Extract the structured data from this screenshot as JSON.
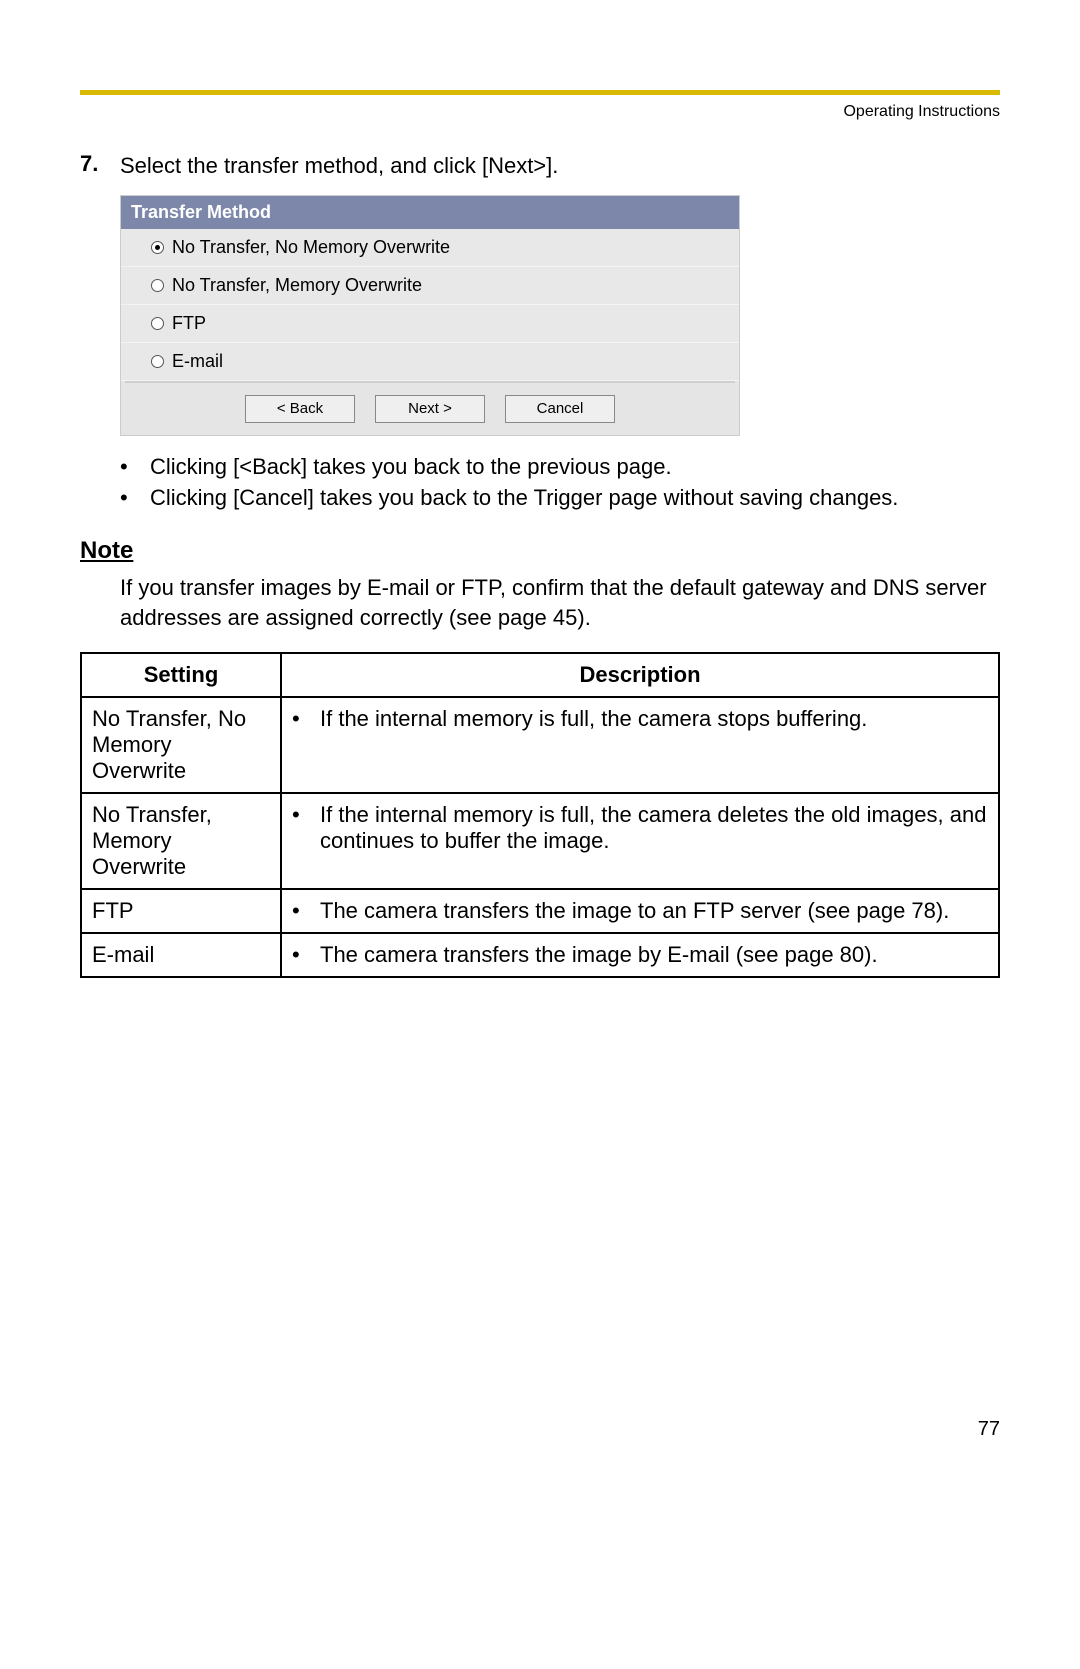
{
  "header": {
    "title": "Operating Instructions"
  },
  "step": {
    "number": "7.",
    "text": "Select the transfer method, and click [Next>]."
  },
  "dialog": {
    "title": "Transfer Method",
    "options": [
      {
        "label": "No Transfer, No Memory Overwrite",
        "selected": true
      },
      {
        "label": "No Transfer, Memory Overwrite",
        "selected": false
      },
      {
        "label": "FTP",
        "selected": false
      },
      {
        "label": "E-mail",
        "selected": false
      }
    ],
    "buttons": {
      "back": "<  Back",
      "next": "Next  >",
      "cancel": "Cancel"
    }
  },
  "bullets": [
    "Clicking [<Back] takes you back to the previous page.",
    "Clicking [Cancel] takes you back to the Trigger page without saving changes."
  ],
  "note": {
    "heading": "Note",
    "body": "If you transfer images by E-mail or FTP, confirm that the default gateway and DNS server addresses are assigned correctly (see page 45)."
  },
  "table": {
    "headers": {
      "setting": "Setting",
      "description": "Description"
    },
    "rows": [
      {
        "setting": "No Transfer, No Memory Overwrite",
        "description": "If the internal memory is full, the camera stops buffering."
      },
      {
        "setting": "No Transfer, Memory Overwrite",
        "description": "If the internal memory is full, the camera deletes the old images, and continues to buffer the image."
      },
      {
        "setting": "FTP",
        "description": "The camera transfers the image to an FTP server (see page 78)."
      },
      {
        "setting": "E-mail",
        "description": "The camera transfers the image by E-mail (see page 80)."
      }
    ]
  },
  "pageNumber": "77"
}
